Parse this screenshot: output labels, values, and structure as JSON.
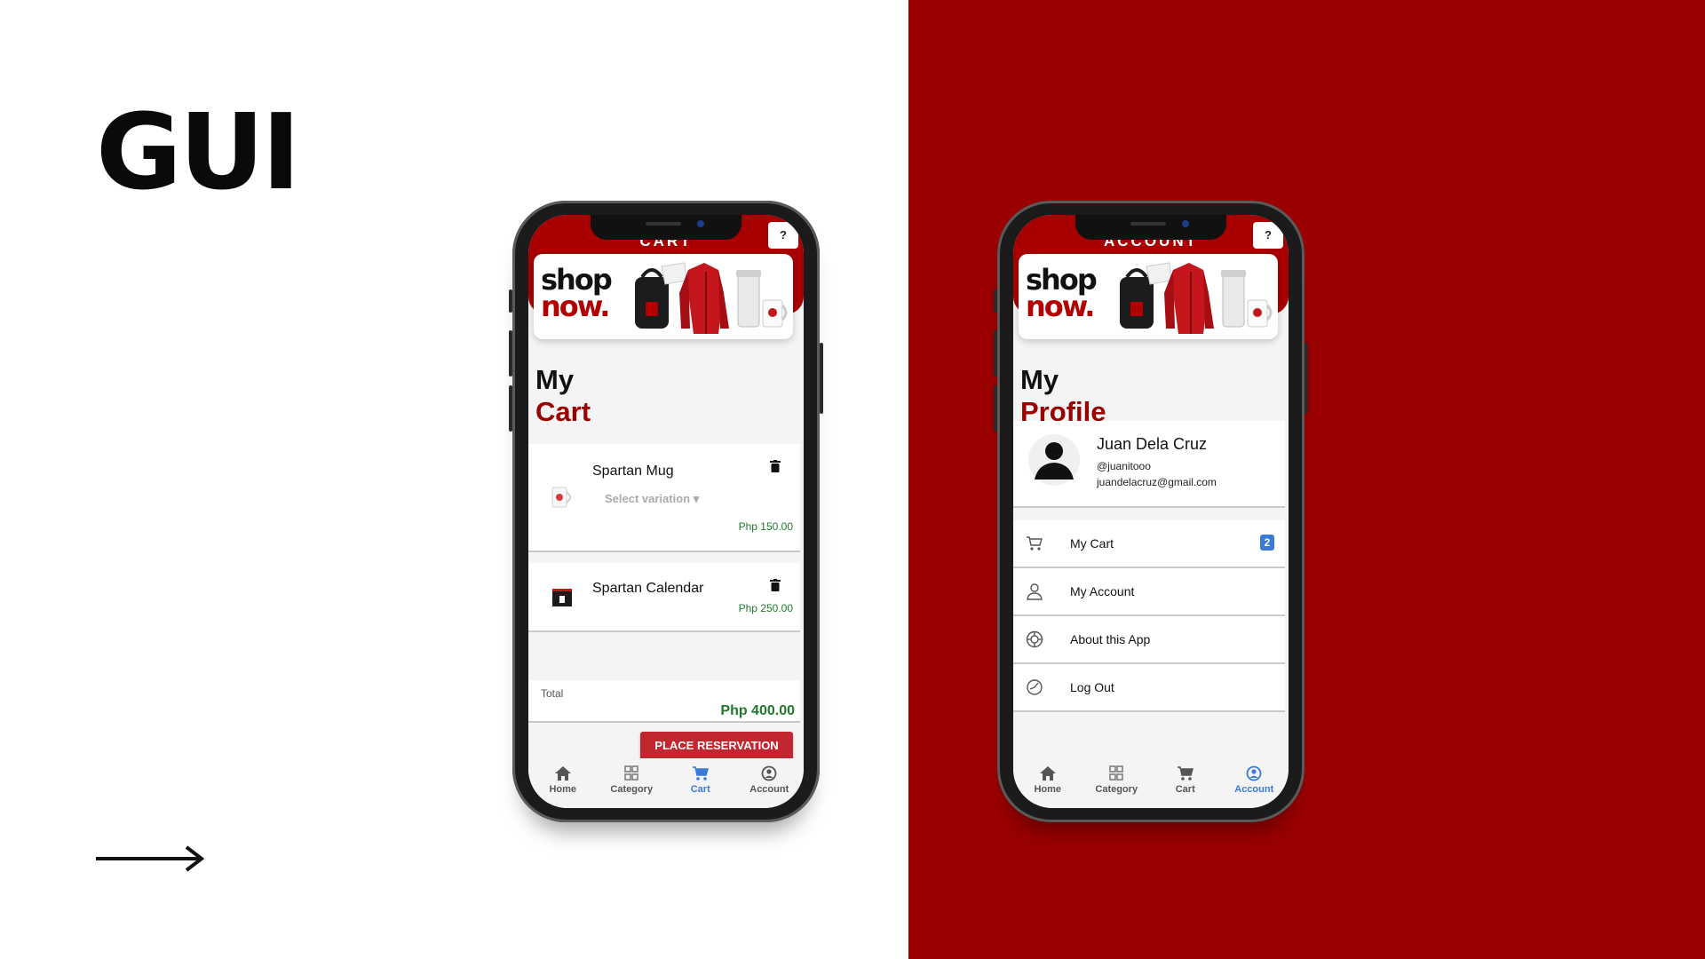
{
  "slide": {
    "title": "GUI",
    "colors": {
      "left_bg": "#ffffff",
      "right_bg": "#9b0000",
      "accent_red": "#a80000",
      "price_green": "#1f7a2e",
      "active_blue": "#3a7bd5"
    }
  },
  "cart_screen": {
    "header_title": "CART",
    "help_label": "?",
    "banner": {
      "word1": "shop",
      "word2": "now."
    },
    "heading_line1": "My",
    "heading_line2": "Cart",
    "items": [
      {
        "name": "Spartan Mug",
        "variation_placeholder": "Select variation ▾",
        "price": "Php 150.00",
        "thumb_icon": "mug-icon"
      },
      {
        "name": "Spartan Calendar",
        "price": "Php 250.00",
        "thumb_icon": "calendar-icon"
      }
    ],
    "total_label": "Total",
    "total_value": "Php 400.00",
    "place_button": "PLACE RESERVATION",
    "active_tab": "Cart"
  },
  "account_screen": {
    "header_title": "ACCOUNT",
    "help_label": "?",
    "banner": {
      "word1": "shop",
      "word2": "now."
    },
    "heading_line1": "My",
    "heading_line2": "Profile",
    "profile": {
      "name": "Juan Dela Cruz",
      "handle": "@juanitooo",
      "email": "juandelacruz@gmail.com"
    },
    "menu": [
      {
        "label": "My Cart",
        "icon": "cart-icon",
        "badge": "2"
      },
      {
        "label": "My Account",
        "icon": "user-icon"
      },
      {
        "label": "About this App",
        "icon": "lifebuoy-icon"
      },
      {
        "label": "Log Out",
        "icon": "logout-icon"
      }
    ],
    "active_tab": "Account"
  },
  "nav": {
    "home": "Home",
    "category": "Category",
    "cart": "Cart",
    "account": "Account"
  }
}
